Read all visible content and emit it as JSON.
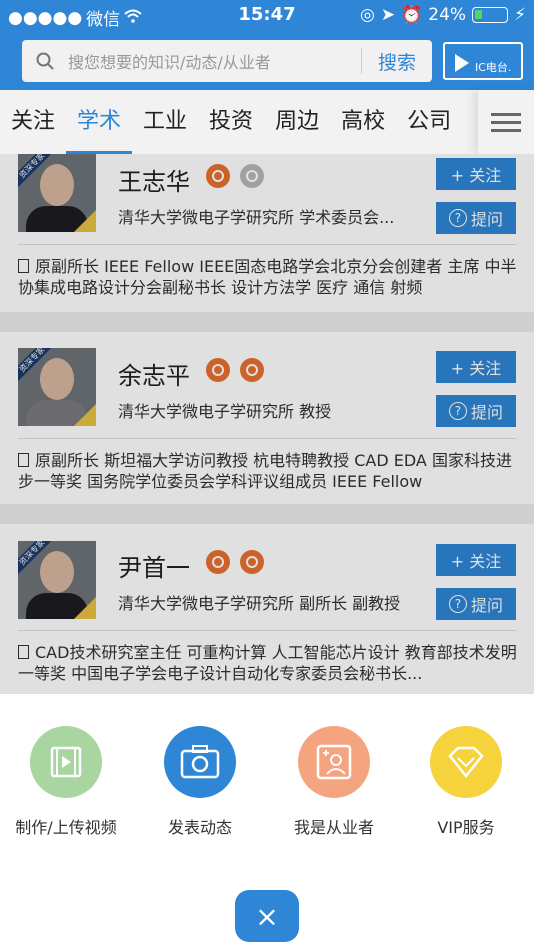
{
  "status": {
    "carrier": "微信",
    "time": "15:47",
    "battery": "24%",
    "battery_level": 0.24
  },
  "header": {
    "search_placeholder": "搜您想要的知识/动态/从业者",
    "search_button": "搜索",
    "ictv_label": "IC电台."
  },
  "tabs": [
    "关注",
    "学术",
    "工业",
    "投资",
    "周边",
    "高校",
    "公司"
  ],
  "active_tab": 1,
  "cards": [
    {
      "name": "王志华",
      "affiliation": "清华大学微电子学研究所  学术委员会...",
      "follow": "+ 关注",
      "ask": "提问",
      "desc": "原副所长 IEEE Fellow IEEE固态电路学会北京分会创建者 主席 中半协集成电路设计分会副秘书长 设计方法学 医疗 通信 射频",
      "badge_tag": "资深专家"
    },
    {
      "name": "余志平",
      "affiliation": "清华大学微电子学研究所  教授",
      "follow": "+ 关注",
      "ask": "提问",
      "desc": "原副所长 斯坦福大学访问教授 杭电特聘教授 CAD EDA 国家科技进步一等奖 国务院学位委员会学科评议组成员 IEEE Fellow",
      "badge_tag": "资深专家"
    },
    {
      "name": "尹首一",
      "affiliation": "清华大学微电子学研究所  副所长 副教授",
      "follow": "+ 关注",
      "ask": "提问",
      "desc": "CAD技术研究室主任 可重构计算 人工智能芯片设计 教育部技术发明一等奖 中国电子学会电子设计自动化专家委员会秘书长...",
      "badge_tag": "资深专家"
    }
  ],
  "actions": [
    {
      "label": "制作/上传视频",
      "color": "#a8d5a0",
      "icon": "video-icon"
    },
    {
      "label": "发表动态",
      "color": "#2f86d6",
      "icon": "camera-icon"
    },
    {
      "label": "我是从业者",
      "color": "#f4a57f",
      "icon": "profile-add-icon"
    },
    {
      "label": "VIP服务",
      "color": "#f6d23c",
      "icon": "diamond-icon"
    }
  ],
  "close_label": "×"
}
